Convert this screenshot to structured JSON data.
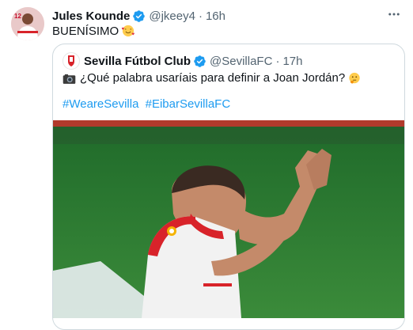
{
  "tweet": {
    "author_name": "Jules Kounde",
    "handle": "@jkeey4",
    "separator": "·",
    "time": "16h",
    "text": "BUENÍSIMO",
    "more_icon": "more-horizontal-icon"
  },
  "quote": {
    "author_name": "Sevilla Fútbol Club",
    "handle": "@SevillaFC",
    "separator": "·",
    "time": "17h",
    "text": "¿Qué palabra usaríais para definir a Joan Jordán?",
    "hashtags": [
      "#WeareSevilla",
      "#EibarSevillaFC"
    ]
  },
  "colors": {
    "link": "#1d9bf0",
    "secondary_text": "#536471",
    "border": "#cfd9de"
  }
}
